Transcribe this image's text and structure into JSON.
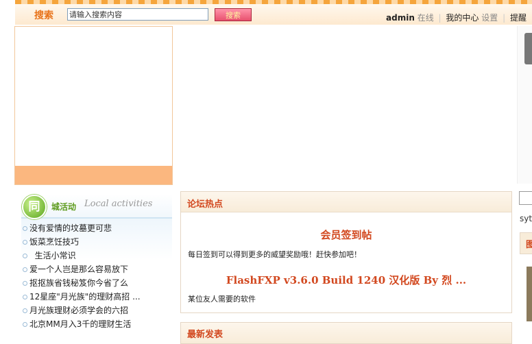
{
  "search": {
    "label": "搜索",
    "input_value": "请输入搜索内容",
    "button_label": "搜索"
  },
  "user": {
    "name": "admin",
    "status": "在线",
    "my_center": "我的中心",
    "settings": "设置",
    "reminder": "提醒"
  },
  "activity": {
    "icon_char": "同",
    "title": "城活动",
    "subtitle": "Local activities",
    "items": [
      "没有爱情的坟墓更可悲",
      "饭菜烹饪技巧",
      "  生活小常识",
      "爱一个人岂是那么容易放下",
      "抠抠族省钱秘笈你今省了么",
      "12星座\"月光族\"的理财高招 ...",
      "月光族理财必须学会的六招",
      "北京MM月入3千的理财生活"
    ]
  },
  "hot": {
    "title": "论坛热点",
    "posts": [
      {
        "title": "会员签到帖",
        "desc": "每日签到可以得到更多的威望奖励哦！赶快参加吧！"
      },
      {
        "title": "FlashFXP v3.6.0 Build 1240 汉化版 By 烈 ...",
        "desc": "某位友人需要的软件"
      }
    ]
  },
  "latest": {
    "title": "最新发表"
  },
  "right": {
    "text": "syt",
    "head": "图"
  }
}
